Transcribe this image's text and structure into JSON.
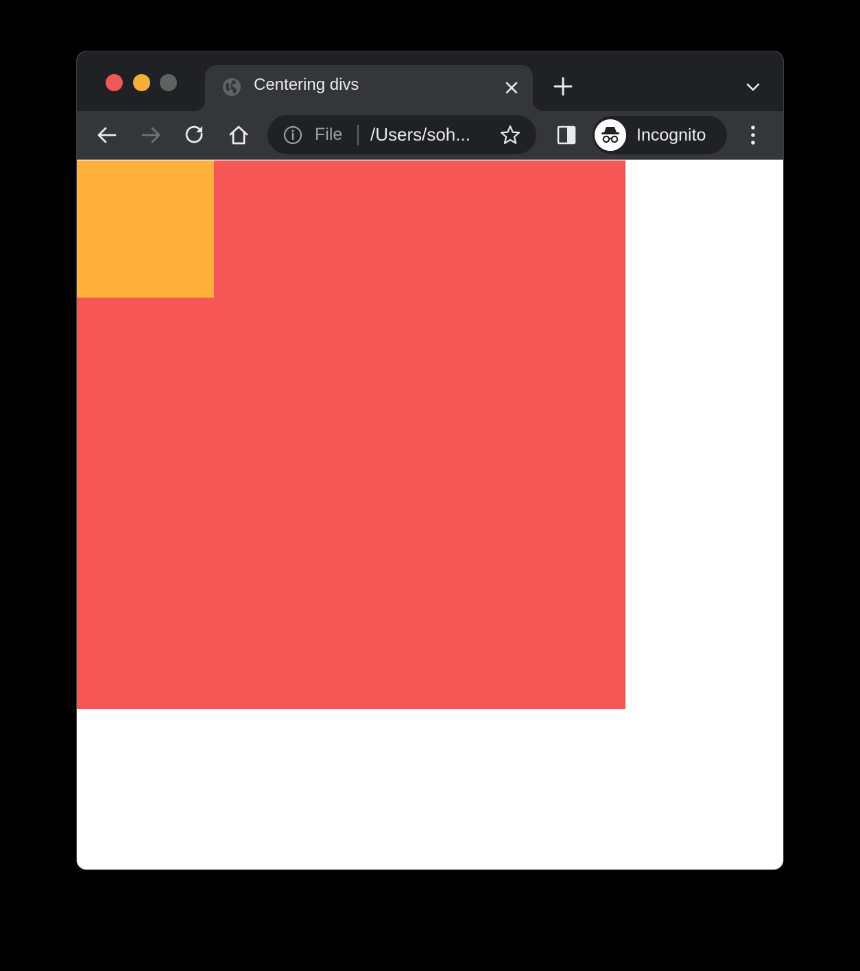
{
  "window": {
    "traffic_lights": {
      "close_color": "#ee5857",
      "minimize_color": "#f5ae3a",
      "maximize_color": "#5e6361"
    }
  },
  "tab": {
    "title": "Centering divs",
    "favicon": "globe-icon",
    "close_icon": "close-icon"
  },
  "tabstrip": {
    "new_tab_icon": "plus-icon",
    "tab_search_icon": "chevron-down-icon"
  },
  "toolbar": {
    "back_icon": "arrow-left-icon",
    "forward_icon": "arrow-right-icon",
    "reload_icon": "reload-icon",
    "home_icon": "home-icon",
    "side_panel_icon": "side-panel-icon",
    "menu_icon": "kebab-menu-icon"
  },
  "omnibox": {
    "info_icon": "info-icon",
    "scheme": "File",
    "url": "/Users/soh...",
    "bookmark_icon": "star-icon"
  },
  "profile": {
    "label": "Incognito",
    "icon": "incognito-icon"
  },
  "page": {
    "background": "#ffffff",
    "outer_box_color": "#f55656",
    "inner_box_color": "#ffb13b"
  }
}
